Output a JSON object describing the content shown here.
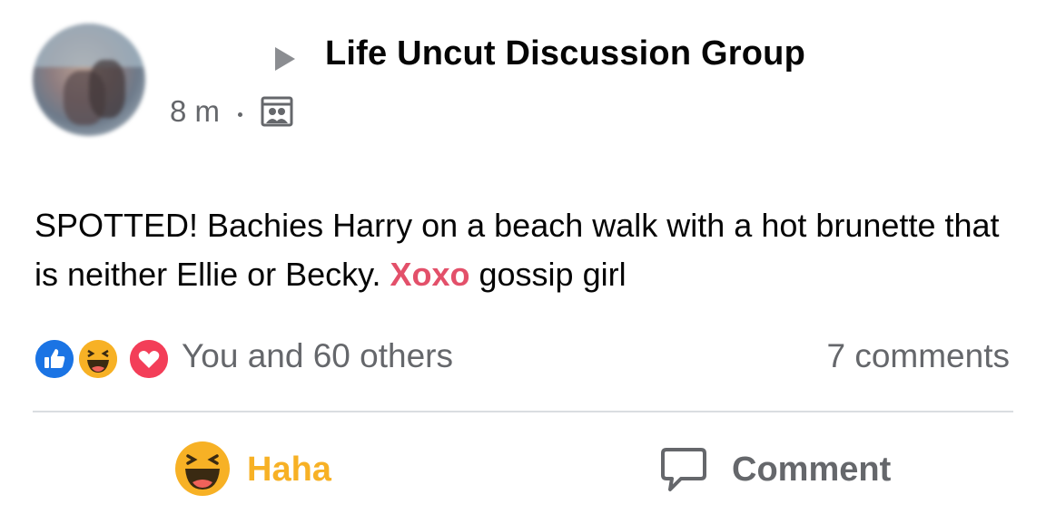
{
  "post": {
    "group_name": "Life Uncut Discussion Group",
    "timestamp": "8 m",
    "separator": "·",
    "audience_icon": "group-icon",
    "text_before": "SPOTTED! Bachies Harry on a beach walk with a hot brunette that is neither Ellie or Becky. ",
    "text_highlight": "Xoxo",
    "text_after": " gossip girl",
    "highlight_color": "#e3506a"
  },
  "engagement": {
    "reaction_icons": [
      "like-icon",
      "haha-icon",
      "love-icon"
    ],
    "reaction_summary": "You and 60 others",
    "comment_count": "7 comments"
  },
  "actions": {
    "haha_label": "Haha",
    "haha_color": "#f7b125",
    "comment_label": "Comment"
  },
  "colors": {
    "text_primary": "#050505",
    "text_secondary": "#65676b",
    "like_blue": "#1b74e4",
    "love_red": "#f33e58"
  }
}
